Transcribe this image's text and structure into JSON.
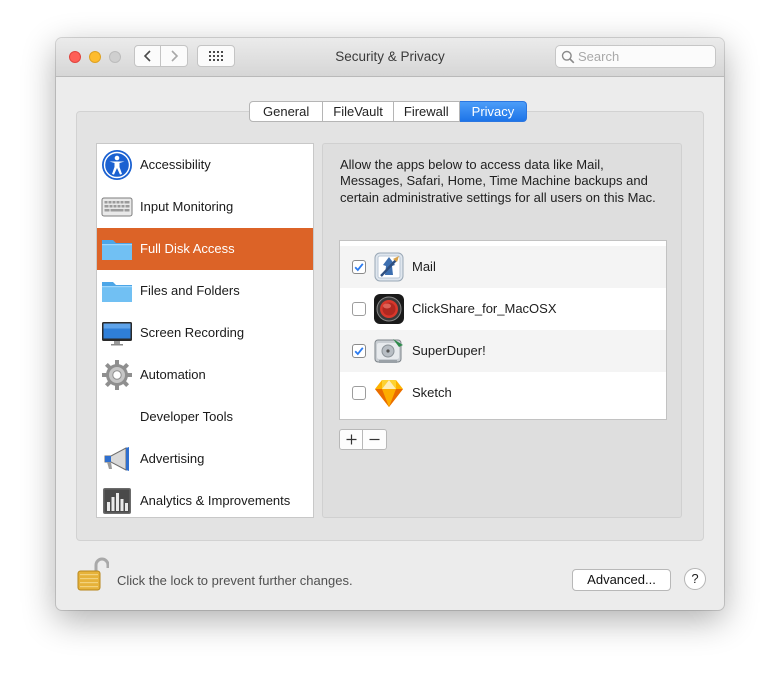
{
  "window": {
    "title": "Security & Privacy"
  },
  "search": {
    "placeholder": "Search"
  },
  "tabs": [
    {
      "label": "General"
    },
    {
      "label": "FileVault"
    },
    {
      "label": "Firewall"
    },
    {
      "label": "Privacy",
      "selected": true
    }
  ],
  "sidebar": {
    "items": [
      {
        "label": "Accessibility",
        "icon": "accessibility-icon"
      },
      {
        "label": "Input Monitoring",
        "icon": "keyboard-icon"
      },
      {
        "label": "Full Disk Access",
        "icon": "folder-icon",
        "selected": true
      },
      {
        "label": "Files and Folders",
        "icon": "folder-icon"
      },
      {
        "label": "Screen Recording",
        "icon": "display-icon"
      },
      {
        "label": "Automation",
        "icon": "gear-icon"
      },
      {
        "label": "Developer Tools",
        "icon": ""
      },
      {
        "label": "Advertising",
        "icon": "megaphone-icon"
      },
      {
        "label": "Analytics & Improvements",
        "icon": "chart-icon"
      }
    ]
  },
  "panel": {
    "description": "Allow the apps below to access data like Mail, Messages, Safari, Home, Time Machine backups and certain administrative settings for all users on this Mac.",
    "apps": [
      {
        "name": "Mail",
        "checked": true,
        "icon": "mail-app-icon"
      },
      {
        "name": "ClickShare_for_MacOSX",
        "checked": false,
        "icon": "clickshare-app-icon"
      },
      {
        "name": "SuperDuper!",
        "checked": true,
        "icon": "superduper-app-icon"
      },
      {
        "name": "Sketch",
        "checked": false,
        "icon": "sketch-app-icon"
      }
    ],
    "add_label": "+",
    "remove_label": "−"
  },
  "footer": {
    "lock_text": "Click the lock to prevent further changes.",
    "advanced_label": "Advanced...",
    "help_label": "?"
  },
  "colors": {
    "selection": "#dc6327",
    "tab_accent": "#1d74e8",
    "checkbox_accent": "#2b7bf0"
  }
}
